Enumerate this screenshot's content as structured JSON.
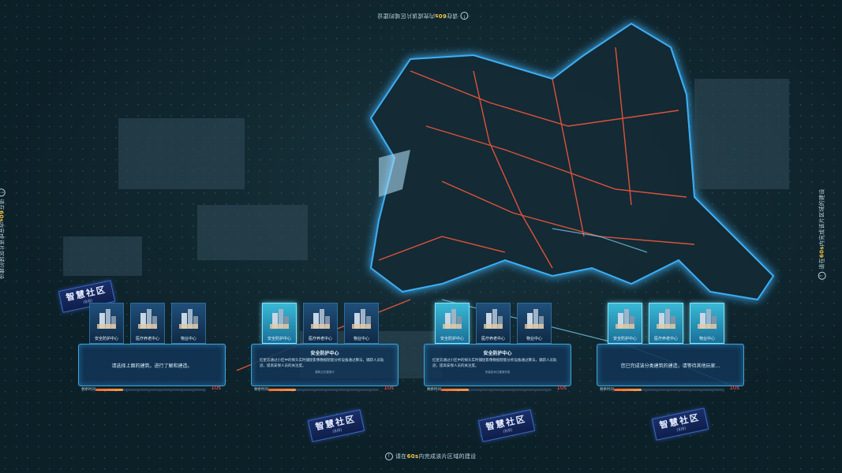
{
  "hints": {
    "prefix": "请在",
    "number": "60s",
    "suffix": "内完成该片区域的建设"
  },
  "tags": [
    {
      "title": "智慧社区",
      "sub": "(8/8)"
    },
    {
      "title": "智慧社区",
      "sub": "(8/8)"
    },
    {
      "title": "智慧社区",
      "sub": "(8/8)"
    },
    {
      "title": "智慧社区",
      "sub": "(8/8)"
    }
  ],
  "cards": [
    {
      "tiles": [
        "安全防护中心",
        "医疗养老中心",
        "物业中心"
      ],
      "selected": -1,
      "title": "",
      "description": "",
      "message": "请选择上面的建筑，进行了解和建造。",
      "sub": "",
      "bar_label": "剩余时间",
      "progress": 0.25,
      "seconds": "10s"
    },
    {
      "tiles": [
        "安全防护中心",
        "医疗养老中心",
        "物业中心"
      ],
      "selected": 0,
      "title": "安全防护中心",
      "description": "红星云通过小区中的探头实时捕捉影像数据智能分析设备通过算法，捕获人员轨迹，提高安保人员的关注度。",
      "message": "",
      "sub": "建筑正在建造中",
      "bar_label": "剩余时间",
      "progress": 0.25,
      "seconds": "10s"
    },
    {
      "tiles": [
        "安全防护中心",
        "医疗养老中心",
        "物业中心"
      ],
      "selected": 0,
      "title": "安全防护中心",
      "description": "红星云通过小区中的探头实时捕捉影像数据智能分析设备通过算法，捕获人员轨迹，提高安保人员的关注度。",
      "message": "",
      "sub": "安装技术已建造完成",
      "bar_label": "剩余时间",
      "progress": 0.25,
      "seconds": "10s"
    },
    {
      "tiles": [
        "安全防护中心",
        "医疗养老中心",
        "物业中心"
      ],
      "selected": 3,
      "title": "",
      "description": "",
      "message": "您已完成该分类建筑的建造，请等待其他玩家...",
      "sub": "",
      "bar_label": "剩余时间",
      "progress": 0.25,
      "seconds": "10s"
    }
  ],
  "colors": {
    "accent": "#3aa6d8",
    "tag": "#1a2f6a",
    "timer": "#ff5a5a",
    "road": "#ff5a3c"
  }
}
